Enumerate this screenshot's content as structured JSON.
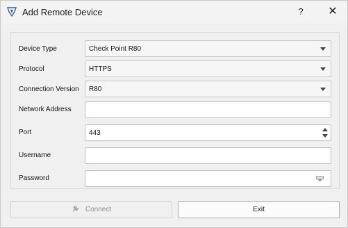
{
  "window": {
    "title": "Add Remote Device",
    "help_label": "?",
    "close_label": "✕",
    "icon": "app-logo-icon"
  },
  "form": {
    "device_type": {
      "label": "Device Type",
      "value": "Check Point R80"
    },
    "protocol": {
      "label": "Protocol",
      "value": "HTTPS"
    },
    "connection_version": {
      "label": "Connection Version",
      "value": "R80"
    },
    "network_address": {
      "label": "Network Address",
      "value": ""
    },
    "port": {
      "label": "Port",
      "value": "443"
    },
    "username": {
      "label": "Username",
      "value": ""
    },
    "password": {
      "label": "Password",
      "value": "",
      "icon": "show-password-icon"
    }
  },
  "buttons": {
    "connect_label": "Connect",
    "connect_icon": "plug-icon",
    "exit_label": "Exit"
  }
}
